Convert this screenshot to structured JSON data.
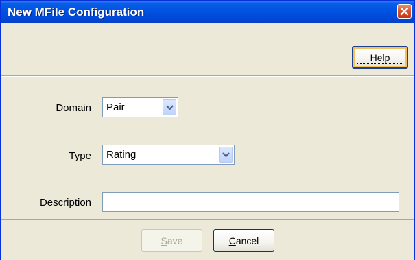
{
  "window": {
    "title": "New MFile Configuration"
  },
  "toolbar": {
    "help_label_u": "H",
    "help_label_rest": "elp"
  },
  "form": {
    "domain": {
      "label": "Domain",
      "value": "Pair"
    },
    "type": {
      "label": "Type",
      "value": "Rating"
    },
    "description": {
      "label": "Description",
      "value": ""
    }
  },
  "footer": {
    "save_label_u": "S",
    "save_label_rest": "ave",
    "save_enabled": false,
    "cancel_label_u": "C",
    "cancel_label_rest": "ancel"
  },
  "colors": {
    "titlebar": "#0054e3",
    "background": "#ece9d8",
    "close": "#d9542e"
  },
  "icons": {
    "close": "close-icon",
    "dropdown": "chevron-down-icon"
  }
}
